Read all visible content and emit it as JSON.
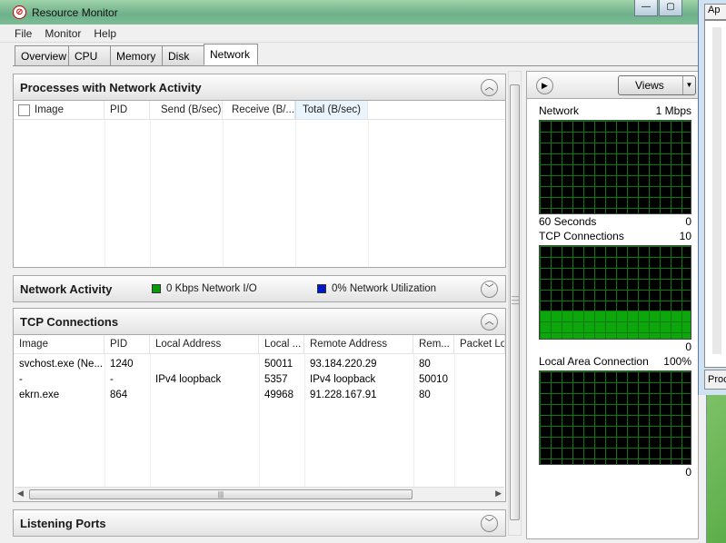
{
  "window": {
    "title": "Resource Monitor",
    "minimize_glyph": "—",
    "maximize_glyph": "▢"
  },
  "menu": [
    "File",
    "Monitor",
    "Help"
  ],
  "tabs": [
    "Overview",
    "CPU",
    "Memory",
    "Disk",
    "Network"
  ],
  "active_tab": "Network",
  "processes": {
    "title": "Processes with Network Activity",
    "columns": [
      "Image",
      "PID",
      "Send (B/sec)",
      "Receive (B/...",
      "Total (B/sec)"
    ],
    "rows": []
  },
  "network_activity": {
    "title": "Network Activity",
    "io_label": "0 Kbps Network I/O",
    "util_label": "0% Network Utilization",
    "io_color": "#0a9a0a",
    "util_color": "#0018c8"
  },
  "tcp": {
    "title": "TCP Connections",
    "columns": [
      "Image",
      "PID",
      "Local Address",
      "Local ...",
      "Remote Address",
      "Rem...",
      "Packet Lo"
    ],
    "rows": [
      [
        "svchost.exe (Ne...",
        "1240",
        "",
        "50011",
        "93.184.220.29",
        "80"
      ],
      [
        "-",
        "-",
        "IPv4 loopback",
        "5357",
        "IPv4 loopback",
        "50010"
      ],
      [
        "ekrn.exe",
        "864",
        "",
        "49968",
        "91.228.167.91",
        "80"
      ]
    ]
  },
  "listening": {
    "title": "Listening Ports"
  },
  "right": {
    "views_label": "Views",
    "graphs": [
      {
        "name": "Network",
        "right_label": "1 Mbps",
        "bottom_left": "60 Seconds",
        "bottom_right": "0",
        "fill_percent": 0
      },
      {
        "name": "TCP Connections",
        "right_label": "10",
        "bottom_left": "",
        "bottom_right": "0",
        "fill_percent": 30
      },
      {
        "name": "Local Area Connection",
        "right_label": "100%",
        "bottom_left": "",
        "bottom_right": "0",
        "fill_percent": 0
      }
    ]
  },
  "side_window": {
    "tab_label": "Ap",
    "bottom_label": "Proc"
  }
}
